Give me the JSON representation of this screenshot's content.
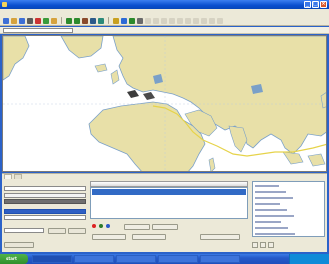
{
  "window": {
    "title": "",
    "controls": [
      "minimize",
      "maximize",
      "close"
    ]
  },
  "menu": {
    "items": [
      "",
      "",
      "",
      "",
      "",
      "",
      "",
      "",
      ""
    ]
  },
  "toolbar": {
    "buttons": [
      {
        "icon": "new-icon",
        "color": "#3d6fd6"
      },
      {
        "icon": "open-icon",
        "color": "#d6a23d"
      },
      {
        "icon": "save-icon",
        "color": "#3d6fd6"
      },
      {
        "icon": "print-icon",
        "color": "#5a5a5a"
      },
      {
        "icon": "cut-icon",
        "color": "#c33"
      },
      {
        "icon": "copy-icon",
        "color": "#3a9b3a"
      },
      {
        "icon": "paste-icon",
        "color": "#d6a23d"
      },
      {
        "icon": "zoom-in-icon",
        "color": "#2c8a2c"
      },
      {
        "icon": "zoom-out-icon",
        "color": "#2c8a2c"
      },
      {
        "icon": "pan-icon",
        "color": "#8a4a2c"
      },
      {
        "icon": "select-icon",
        "color": "#2c5a8a"
      },
      {
        "icon": "layer-icon",
        "color": "#2c8a7a"
      },
      {
        "icon": "route-icon",
        "color": "#c8a020"
      },
      {
        "icon": "info-icon",
        "color": "#2c6ad6"
      },
      {
        "icon": "globe-icon",
        "color": "#2c8a2c"
      },
      {
        "icon": "settings-icon",
        "color": "#6a6a6a"
      }
    ]
  },
  "map": {
    "ocean_color": "#ffffff",
    "land_color": "#e8e0a8",
    "coast_color": "#7aa0c8",
    "route_color": "#e6d34a"
  },
  "bottom_panel": {
    "tabs": [
      "",
      ""
    ],
    "left": {
      "labels": [
        "",
        "",
        ""
      ]
    },
    "middle": {
      "header": "",
      "buttons": [
        "",
        "",
        "",
        "",
        ""
      ]
    },
    "right": {
      "buttons": [
        "",
        "",
        ""
      ]
    }
  },
  "taskbar": {
    "start_label": "start",
    "tasks": [
      "",
      "",
      "",
      "",
      ""
    ],
    "clock": ""
  }
}
